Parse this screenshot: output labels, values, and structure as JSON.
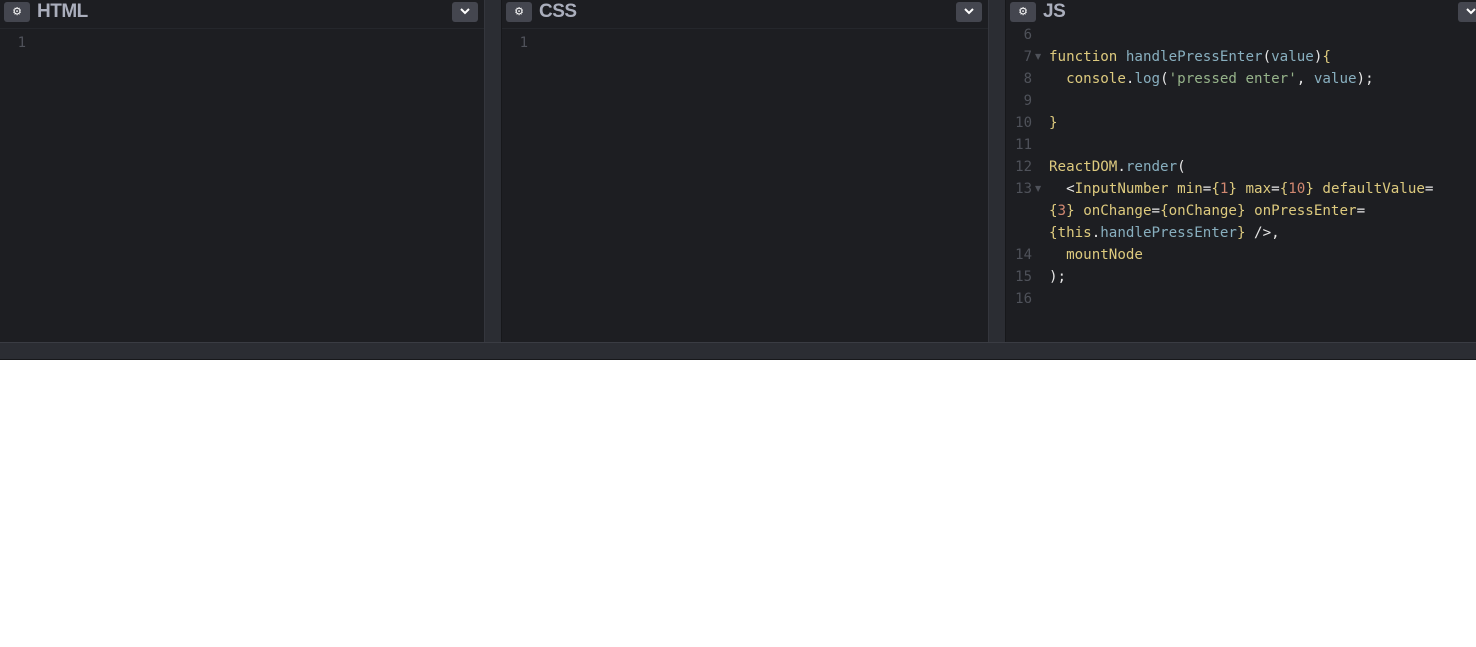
{
  "panels": {
    "html": {
      "title": "HTML",
      "lines": [
        "1"
      ]
    },
    "css": {
      "title": "CSS",
      "lines": [
        "1"
      ]
    },
    "js": {
      "title": "JS",
      "line_numbers": [
        "6",
        "7",
        "8",
        "9",
        "10",
        "11",
        "12",
        "13",
        "",
        "",
        "14",
        "15",
        "16"
      ],
      "code_lines": [
        "",
        "function handlePressEnter(value){",
        "  console.log('pressed enter', value);",
        "",
        "}",
        "",
        "ReactDOM.render(",
        "  <InputNumber min={1} max={10} defaultValue=",
        "{3} onChange={onChange} onPressEnter=",
        "{this.handlePressEnter} />,",
        "  mountNode",
        ");",
        ""
      ]
    }
  },
  "icons": {
    "settings": "gear-icon",
    "collapse": "chevron-down-icon"
  },
  "colors": {
    "editor_bg": "#1d1e22",
    "resizer": "#2b2d33",
    "title": "#aaaebc",
    "keyword": "#ddca7e",
    "function": "#88afbf",
    "string": "#96b38a",
    "number": "#d08770"
  }
}
